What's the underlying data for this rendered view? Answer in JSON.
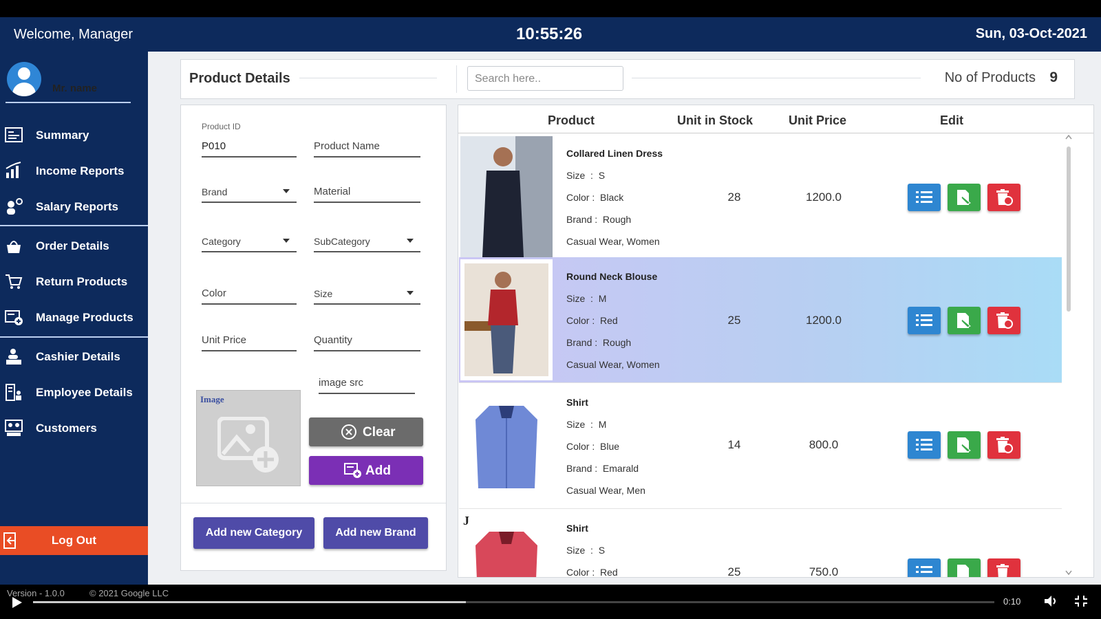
{
  "header": {
    "welcome": "Welcome, Manager",
    "clock": "10:55:26",
    "date": "Sun, 03-Oct-2021"
  },
  "sidebar": {
    "user_name": "Mr. name",
    "items": [
      {
        "label": "Summary",
        "icon": "summary-icon"
      },
      {
        "label": "Income Reports",
        "icon": "bar-chart-icon"
      },
      {
        "label": "Salary Reports",
        "icon": "salary-icon"
      },
      {
        "label": "Order Details",
        "icon": "bag-icon"
      },
      {
        "label": "Return Products",
        "icon": "cart-return-icon"
      },
      {
        "label": "Manage Products",
        "icon": "manage-products-icon"
      },
      {
        "label": "Cashier Details",
        "icon": "cashier-icon"
      },
      {
        "label": "Employee Details",
        "icon": "employee-icon"
      },
      {
        "label": "Customers",
        "icon": "customers-icon"
      }
    ],
    "logout": "Log Out"
  },
  "product_header": {
    "title": "Product Details",
    "search_placeholder": "Search here..",
    "count_label": "No of Products",
    "count": "9"
  },
  "form": {
    "product_id_caption": "Product ID",
    "product_id": "P010",
    "product_name": "Product Name",
    "brand": "Brand",
    "material": "Material",
    "category": "Category",
    "subcategory": "SubCategory",
    "color": "Color",
    "size": "Size",
    "unit_price": "Unit Price",
    "quantity": "Quantity",
    "image_src": "image src",
    "image_label": "Image",
    "clear": "Clear",
    "add": "Add",
    "add_category": "Add new Category",
    "add_brand": "Add new Brand"
  },
  "table": {
    "headers": {
      "product": "Product",
      "stock": "Unit in Stock",
      "price": "Unit Price",
      "edit": "Edit"
    },
    "size_label": "Size",
    "color_label": "Color",
    "brand_label": "Brand",
    "rows": [
      {
        "name": "Collared Linen Dress",
        "size": "S",
        "color": "Black",
        "brand": "Rough",
        "tags": "Casual Wear, Women",
        "stock": "28",
        "price": "1200.0"
      },
      {
        "name": "Round Neck Blouse",
        "size": "M",
        "color": "Red",
        "brand": "Rough",
        "tags": "Casual Wear, Women",
        "stock": "25",
        "price": "1200.0"
      },
      {
        "name": "Shirt",
        "size": "M",
        "color": "Blue",
        "brand": "Emarald",
        "tags": "Casual Wear, Men",
        "stock": "14",
        "price": "800.0"
      },
      {
        "name": "Shirt",
        "size": "S",
        "color": "Red",
        "brand": "",
        "tags": "",
        "stock": "25",
        "price": "750.0"
      }
    ]
  },
  "video": {
    "version": "Version - 1.0.0",
    "copyright": "© 2021 Google LLC",
    "time": "0:10",
    "progress": 0.45
  },
  "colors": {
    "sidebar": "#0d2a5c",
    "logout": "#e94d25",
    "add": "#7b2fb5",
    "clear": "#6b6b6b",
    "category": "#4f4ba8",
    "view": "#2e86d1",
    "edit": "#3aa94a",
    "delete": "#e0323d"
  }
}
